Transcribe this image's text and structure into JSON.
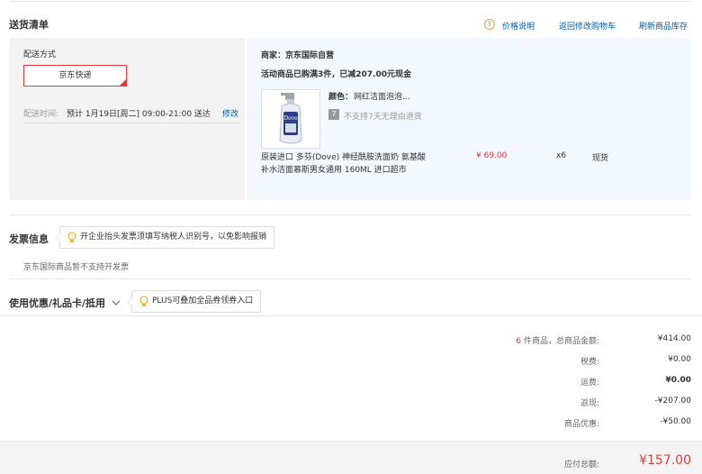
{
  "delivery": {
    "title": "送货清单",
    "links": {
      "price_note": "价格说明",
      "back_to_cart": "返回修改购物车",
      "refresh_stock": "刷新商品库存"
    },
    "ship_method_label": "配送方式",
    "ship_method_value": "京东快递",
    "ship_time_label": "配送时间:",
    "ship_time_value": "预计 1月19日[周二] 09:00-21:00 送达",
    "modify": "修改",
    "seller": "商家：京东国际自营",
    "promo": "活动商品已购满3件，已减207.00元现金",
    "item": {
      "color_label": "颜色：",
      "color_value": "网红洁面泡泡...",
      "return_note": "不支持7天无理由退货",
      "return_icon_text": "7",
      "name_line1": "原装进口 多芬(Dove) 神经酰胺洗面奶 氨基酸",
      "name_line2": "补水洁面慕斯男女通用 160ML 进口超市",
      "price": "¥ 69.00",
      "qty": "x6",
      "stock": "现货",
      "thumb_brand": "Dove"
    }
  },
  "invoice": {
    "title": "发票信息",
    "tip": "开企业抬头发票须填写纳税人识别号，以免影响报销",
    "note": "京东国际商品暂不支持开发票"
  },
  "coupon": {
    "title": "使用优惠/礼品卡/抵用",
    "tip": "PLUS可叠加全品券领券入口"
  },
  "summary": {
    "count": "6",
    "count_suffix": " 件商品，总商品金额:",
    "goods_total": "¥414.00",
    "tax_label": "税费:",
    "tax": "¥0.00",
    "freight_label": "运费:",
    "freight": "¥0.00",
    "rebate_label": "返现:",
    "rebate": "-¥207.00",
    "discount_label": "商品优惠:",
    "discount": "-¥50.00",
    "payable_label": "应付总额:",
    "payable": "¥157.00"
  },
  "colors": {
    "accent": "#e4393c",
    "link": "#005ea7",
    "tip_icon": "#f3b43c"
  }
}
